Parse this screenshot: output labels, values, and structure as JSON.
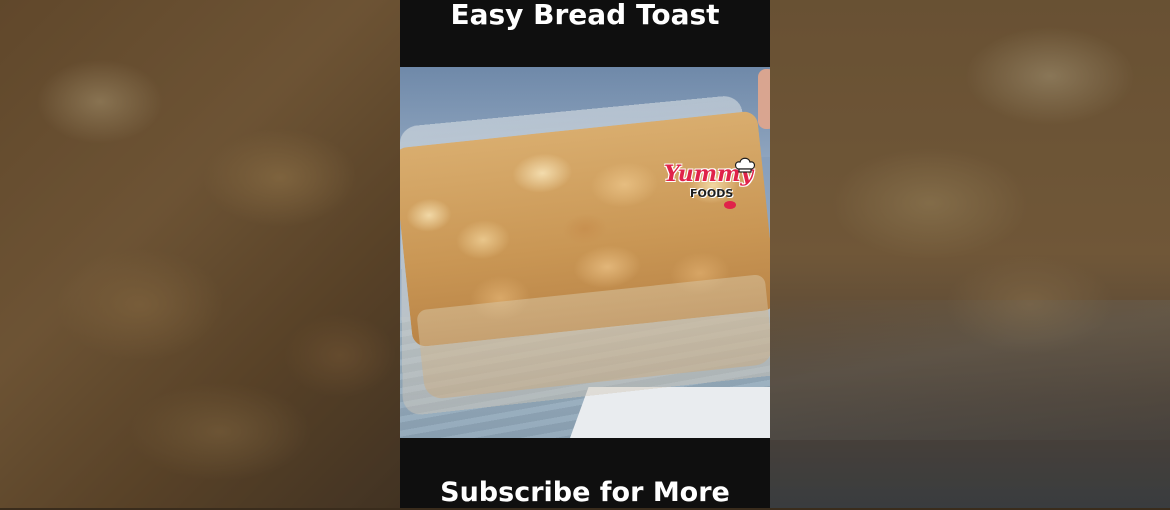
{
  "video": {
    "title": "Easy Bread Toast",
    "subtitle": "Subscribe for More"
  },
  "logo": {
    "line1": "Yummy",
    "line2": "FOODS"
  },
  "colors": {
    "frame_background": "#0f0f0f",
    "caption_text": "#ffffff",
    "logo_accent": "#e0234a"
  }
}
